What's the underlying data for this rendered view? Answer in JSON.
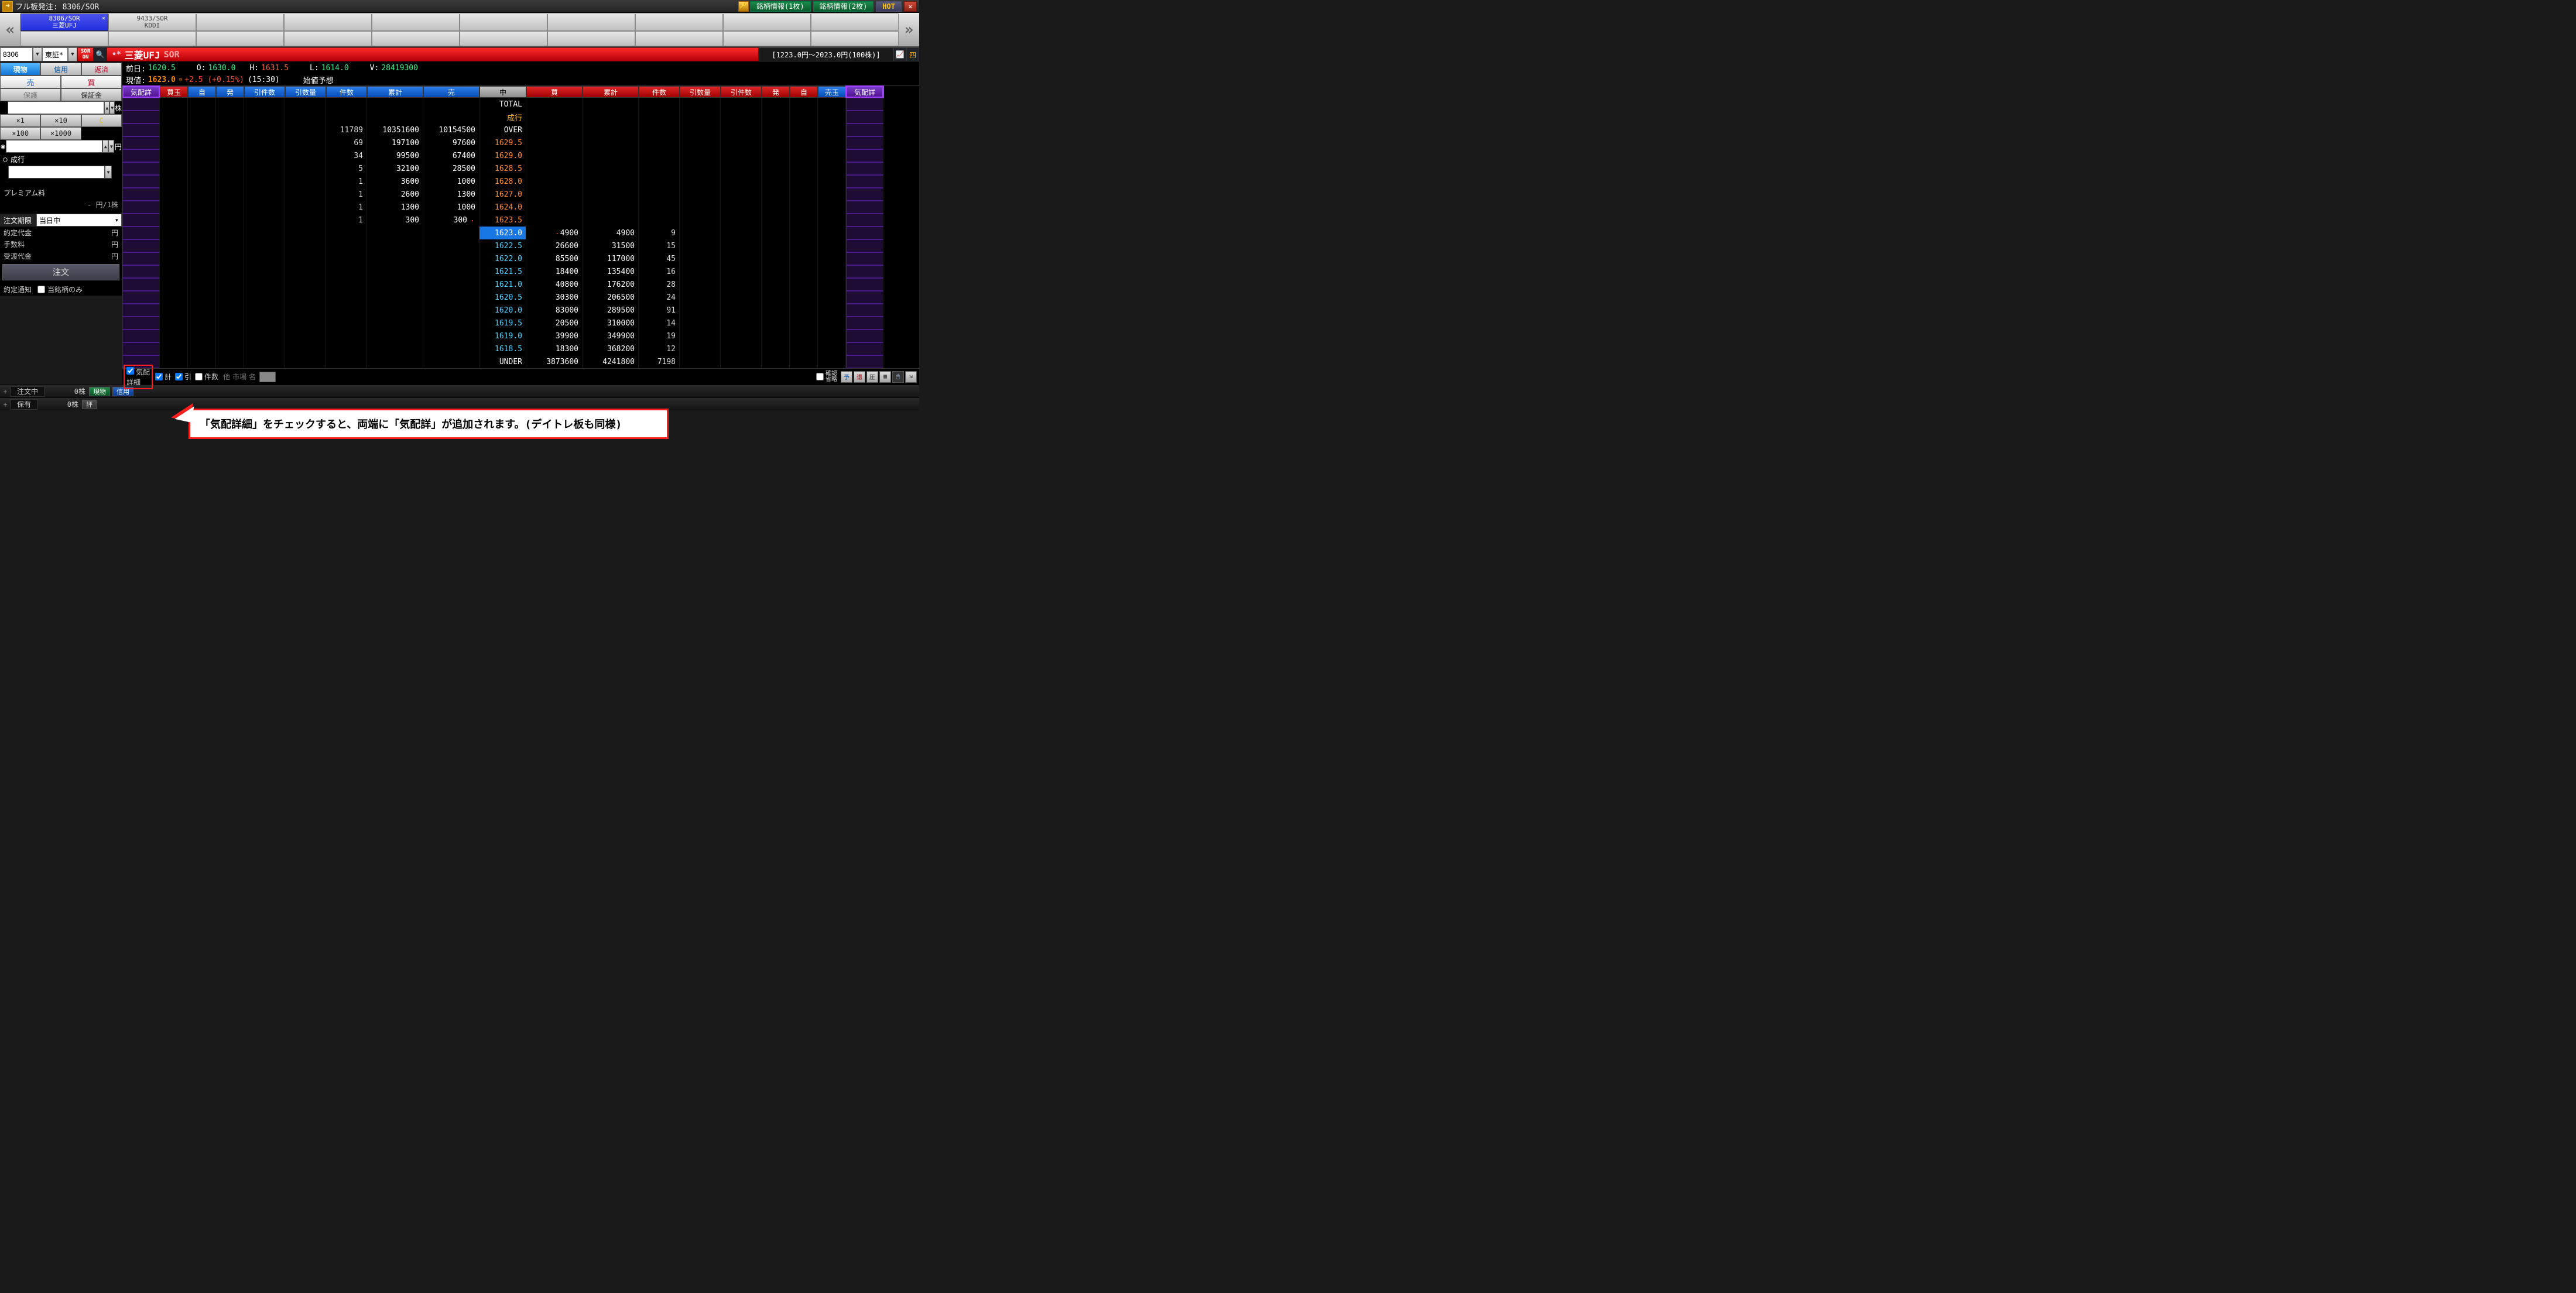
{
  "window": {
    "title": "フル板発注: 8306/SOR",
    "info1_label": "銘柄情報(1枚)",
    "info2_label": "銘柄情報(2枚)",
    "hot_label": "HOT"
  },
  "tabs": [
    {
      "code": "8306/SOR",
      "name": "三菱UFJ",
      "active": true
    },
    {
      "code": "9433/SOR",
      "name": "KDDI",
      "active": false
    }
  ],
  "symbol_bar": {
    "code": "8306",
    "market": "東証*",
    "sor_toggle_top": "SOR",
    "sor_toggle_bottom": "ON",
    "star": "•*",
    "name": "三菱UFJ",
    "sor_suffix": "SOR",
    "range": "[1223.0円～2023.0円(100株)]"
  },
  "ohlc": {
    "prev_label": "前日:",
    "prev": "1620.5",
    "open_label": "O:",
    "open": "1630.0",
    "high_label": "H:",
    "high": "1631.5",
    "low_label": "L:",
    "low": "1614.0",
    "vol_label": "V:",
    "vol": "28419300",
    "cur_label": "現値:",
    "cur": "1623.0",
    "cur_mark": "◎",
    "change": "+2.5 (+0.15%)",
    "time": "(15:30)",
    "note": "始値予想"
  },
  "order_panel": {
    "tab_genbutsu": "現物",
    "tab_shinyou": "信用",
    "tab_hensai": "返済",
    "sell": "売",
    "buy": "買",
    "hoken": "保護",
    "hoshokin": "保証金",
    "unit_kabu": "株",
    "x1": "×1",
    "x10": "×10",
    "clear": "C",
    "x100": "×100",
    "x1000": "×1000",
    "unit_yen": "円",
    "nariyuki": "成行",
    "premium_label": "プレミアム料",
    "premium_value": "-   円/1株",
    "kigen_label": "注文期限",
    "kigen_value": "当日中",
    "yakudai_label": "約定代金",
    "yakudai_unit": "円",
    "tesuryo_label": "手数料",
    "tesuryo_unit": "円",
    "ukewatashi_label": "受渡代金",
    "ukewatashi_unit": "円",
    "submit": "注文",
    "notify_label": "約定通知",
    "tomei_label": "当銘柄のみ"
  },
  "board_headers": {
    "kehai_detail": "気配詳",
    "kaitama": "買玉",
    "ji": "自",
    "hatsu": "発",
    "hiki_ken": "引件数",
    "hiki_su": "引数量",
    "kensu": "件数",
    "ruikei": "累計",
    "uri": "売",
    "naka": "中",
    "kai": "買",
    "uritama": "売玉"
  },
  "board_meta": {
    "total": "TOTAL",
    "nari": "成行",
    "over": "OVER",
    "under": "UNDER"
  },
  "board_rows": {
    "over": {
      "ken": "11789",
      "rui": "10351600",
      "vol": "10154500"
    },
    "asks": [
      {
        "price": "1629.5",
        "ken": "69",
        "rui": "197100",
        "vol": "97600"
      },
      {
        "price": "1629.0",
        "ken": "34",
        "rui": "99500",
        "vol": "67400"
      },
      {
        "price": "1628.5",
        "ken": "5",
        "rui": "32100",
        "vol": "28500"
      },
      {
        "price": "1628.0",
        "ken": "1",
        "rui": "3600",
        "vol": "1000"
      },
      {
        "price": "1627.0",
        "ken": "1",
        "rui": "2600",
        "vol": "1300"
      },
      {
        "price": "1624.0",
        "ken": "1",
        "rui": "1300",
        "vol": "1000"
      },
      {
        "price": "1623.5",
        "ken": "1",
        "rui": "300",
        "vol": "300",
        "mark": true
      }
    ],
    "current": {
      "price": "1623.0",
      "kai": "4900",
      "rui": "4900",
      "ken": "9",
      "mark": true
    },
    "bids": [
      {
        "price": "1622.5",
        "kai": "26600",
        "rui": "31500",
        "ken": "15"
      },
      {
        "price": "1622.0",
        "kai": "85500",
        "rui": "117000",
        "ken": "45"
      },
      {
        "price": "1621.5",
        "kai": "18400",
        "rui": "135400",
        "ken": "16"
      },
      {
        "price": "1621.0",
        "kai": "40800",
        "rui": "176200",
        "ken": "28"
      },
      {
        "price": "1620.5",
        "kai": "30300",
        "rui": "206500",
        "ken": "24"
      },
      {
        "price": "1620.0",
        "kai": "83000",
        "rui": "289500",
        "ken": "91"
      },
      {
        "price": "1619.5",
        "kai": "20500",
        "rui": "310000",
        "ken": "14"
      },
      {
        "price": "1619.0",
        "kai": "39900",
        "rui": "349900",
        "ken": "19"
      },
      {
        "price": "1618.5",
        "kai": "18300",
        "rui": "368200",
        "ken": "12"
      }
    ],
    "under": {
      "kai": "3873600",
      "rui": "4241800",
      "ken": "7198"
    }
  },
  "footer": {
    "kehai_detail": "気配\n詳細",
    "kei": "計",
    "hiki": "引",
    "kensu": "件数",
    "ta": "他",
    "shijo": "市場",
    "mei": "名",
    "kakunin": "確認",
    "shoryaku": "省略",
    "mini_yo": "予",
    "mini_tai": "退",
    "mini_atsu": "圧"
  },
  "status": {
    "chuumon": "注文中",
    "zero": "0株",
    "genbutsu": "現物",
    "shinyou": "信用",
    "hoyuu": "保有",
    "hyou": "評"
  },
  "callout": "「気配詳細」をチェックすると、両端に「気配詳」が追加されます。(デイトレ板も同様)"
}
